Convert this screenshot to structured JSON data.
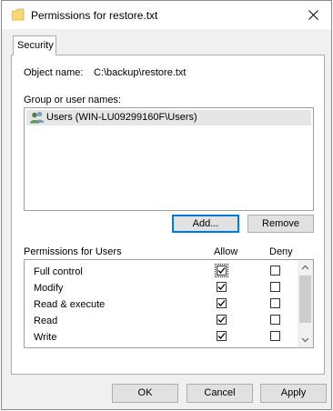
{
  "window": {
    "title": "Permissions for restore.txt"
  },
  "tabs": [
    {
      "label": "Security"
    }
  ],
  "object": {
    "label": "Object name:",
    "value": "C:\\backup\\restore.txt"
  },
  "groups": {
    "label": "Group or user names:",
    "items": [
      {
        "name": "Users (WIN-LU09299160F\\Users)",
        "icon": "users-icon",
        "selected": true
      }
    ]
  },
  "buttons": {
    "add": "Add...",
    "remove": "Remove",
    "ok": "OK",
    "cancel": "Cancel",
    "apply": "Apply"
  },
  "permissions": {
    "label": "Permissions for Users",
    "allow_label": "Allow",
    "deny_label": "Deny",
    "rows": [
      {
        "name": "Full control",
        "allow": true,
        "deny": false
      },
      {
        "name": "Modify",
        "allow": true,
        "deny": false
      },
      {
        "name": "Read & execute",
        "allow": true,
        "deny": false
      },
      {
        "name": "Read",
        "allow": true,
        "deny": false
      },
      {
        "name": "Write",
        "allow": true,
        "deny": false
      }
    ]
  },
  "colors": {
    "accent": "#0078d7",
    "dialog_bg": "#f0f0f0",
    "selection": "#e6e6e6"
  }
}
